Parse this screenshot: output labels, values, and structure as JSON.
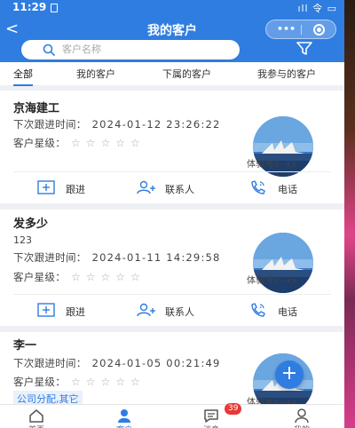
{
  "status": {
    "time": "11:29",
    "right": "ıll 令 ▭"
  },
  "header": {
    "title": "我的客户",
    "back": "<"
  },
  "capsule": {
    "more": "•••"
  },
  "search": {
    "placeholder": "客户名称"
  },
  "tabs": [
    {
      "label": "全部",
      "active": true
    },
    {
      "label": "我的客户",
      "active": false
    },
    {
      "label": "下属的客户",
      "active": false
    },
    {
      "label": "我参与的客户",
      "active": false
    }
  ],
  "labels": {
    "next_followup": "下次跟进时间：",
    "star_level": "客户星级：",
    "stars": "☆☆☆☆☆"
  },
  "actions": {
    "follow": "跟进",
    "contacts": "联系人",
    "phone": "电话"
  },
  "customers": [
    {
      "name": "京海建工",
      "next_time": "2024-01-12 23:26:22",
      "experience": "体验号s--xx"
    },
    {
      "name": "发多少",
      "sub": "123",
      "next_time": "2024-01-11 14:29:58",
      "experience": "体验号s--xx"
    },
    {
      "name": "李一",
      "next_time": "2024-01-05 00:21:49",
      "tag": "公司分配,其它",
      "experience": "体验号s--xx"
    }
  ],
  "fab": "+",
  "tabbar": {
    "items": [
      {
        "label": "首页",
        "icon": "home-icon"
      },
      {
        "label": "客户",
        "icon": "person-icon"
      },
      {
        "label": "消息",
        "icon": "message-icon"
      },
      {
        "label": "我的",
        "icon": "profile-icon"
      }
    ],
    "badge": "39"
  },
  "colors": {
    "primary": "#2f7de1",
    "badge": "#e53935"
  }
}
